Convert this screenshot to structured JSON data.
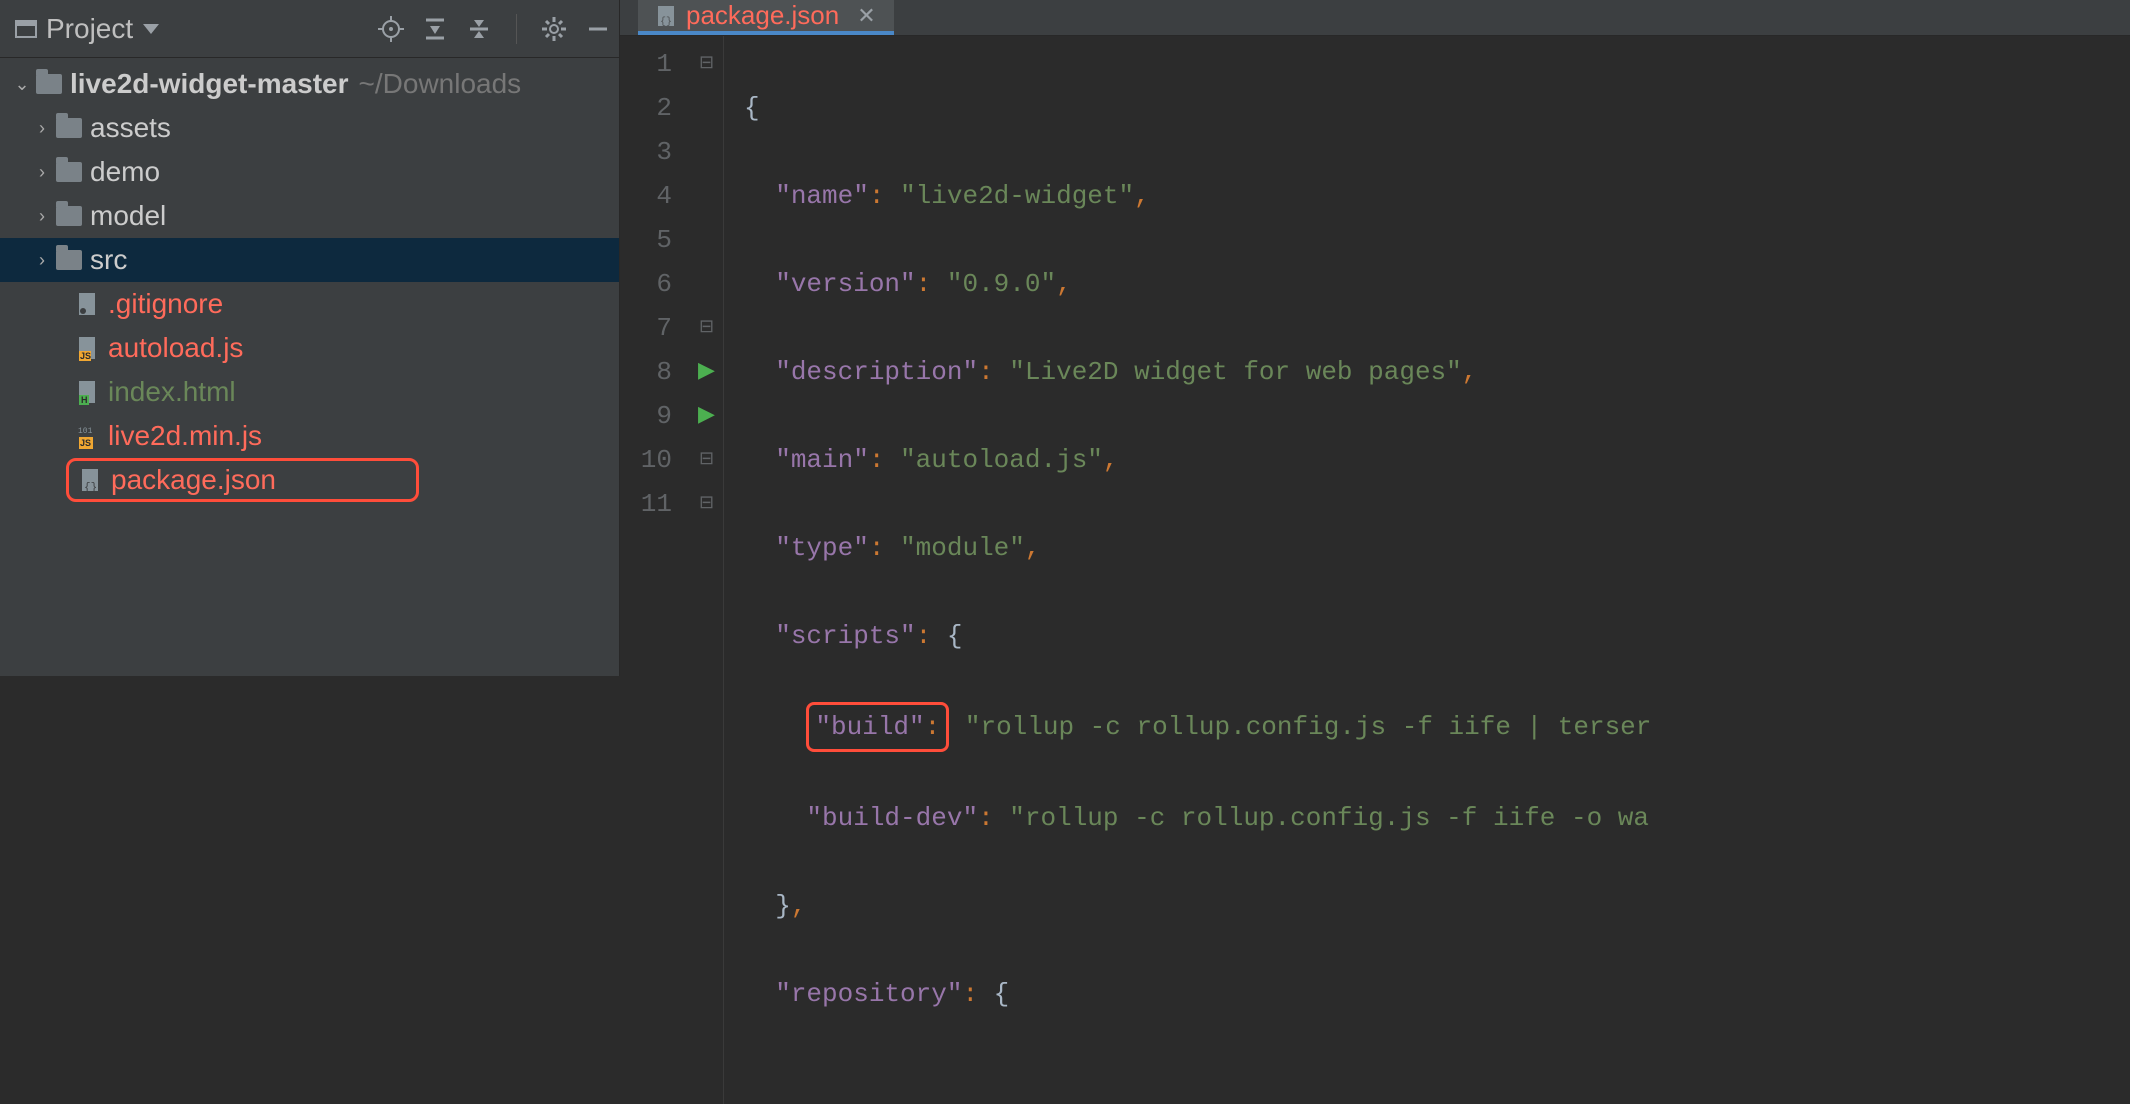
{
  "sidebar": {
    "title": "Project",
    "root": {
      "name": "live2d-widget-master",
      "hint": "~/Downloads"
    },
    "items": [
      {
        "label": "assets"
      },
      {
        "label": "demo"
      },
      {
        "label": "model"
      },
      {
        "label": "src"
      },
      {
        "label": ".gitignore"
      },
      {
        "label": "autoload.js"
      },
      {
        "label": "index.html"
      },
      {
        "label": "live2d.min.js"
      },
      {
        "label": "package.json"
      }
    ]
  },
  "tab": {
    "label": "package.json"
  },
  "file": {
    "name_key": "\"name\"",
    "name_val": "\"live2d-widget\"",
    "version_key": "\"version\"",
    "version_val": "\"0.9.0\"",
    "desc_key": "\"description\"",
    "desc_val": "\"Live2D widget for web pages\"",
    "main_key": "\"main\"",
    "main_val": "\"autoload.js\"",
    "type_key": "\"type\"",
    "type_val": "\"module\"",
    "scripts_key": "\"scripts\"",
    "build_key": "\"build\"",
    "build_val": "\"rollup -c rollup.config.js -f iife | terser",
    "builddev_key": "\"build-dev\"",
    "builddev_val": "\"rollup -c rollup.config.js -f iife -o wa",
    "repo_key": "\"repository\""
  },
  "gutter": [
    "1",
    "2",
    "3",
    "4",
    "5",
    "6",
    "7",
    "8",
    "9",
    "10",
    "11"
  ]
}
